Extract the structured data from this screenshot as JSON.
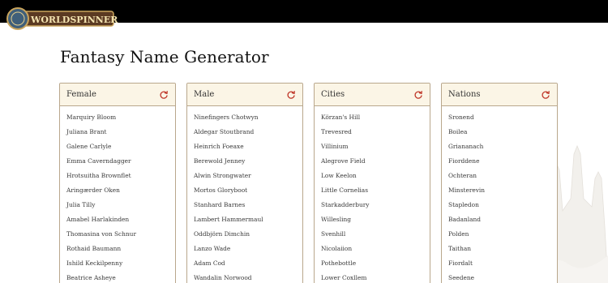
{
  "app": {
    "logo_text": "WORLDSPINNER"
  },
  "page": {
    "title": "Fantasy Name Generator"
  },
  "colors": {
    "accent": "#c0392b",
    "border": "#b9a78c",
    "header_bg": "#fbf5e6"
  },
  "panels": [
    {
      "title": "Female",
      "icon": "refresh-icon",
      "items": [
        "Marquiry Bloom",
        "Juliana Brant",
        "Galene Carlyle",
        "Emma Caverndagger",
        "Hrotsuitha Brownflet",
        "Aringærder Oken",
        "Julia Tilly",
        "Amabel Harlakinden",
        "Thomasina von Schnur",
        "Rothaid Baumann",
        "Ishild Keckilpenny",
        "Beatrice Asheye"
      ]
    },
    {
      "title": "Male",
      "icon": "refresh-icon",
      "items": [
        "Ninefingers Chotwyn",
        "Aldegar Stoutbrand",
        "Heinrich Foeaxe",
        "Berewold Jenney",
        "Alwin Strongwater",
        "Mortos Gloryboot",
        "Stanhard Barnes",
        "Lambert Hammermaul",
        "Oddbjörn Dimchin",
        "Lanzo Wade",
        "Adam Cod",
        "Wandalin Norwood"
      ]
    },
    {
      "title": "Cities",
      "icon": "refresh-icon",
      "items": [
        "Körzan's Hill",
        "Trevesred",
        "Villinium",
        "Alegrove Field",
        "Low Keelon",
        "Little Cornelias",
        "Starkadderbury",
        "Willesling",
        "Svenhill",
        "Nicolaiion",
        "Pothebottle",
        "Lower Coxllem"
      ]
    },
    {
      "title": "Nations",
      "icon": "refresh-icon",
      "items": [
        "Sronend",
        "Boilea",
        "Griananach",
        "Fiorddene",
        "Ochteran",
        "Minsterevin",
        "Stapledon",
        "Badanland",
        "Polden",
        "Taithan",
        "Fiordalt",
        "Seedene"
      ]
    }
  ]
}
